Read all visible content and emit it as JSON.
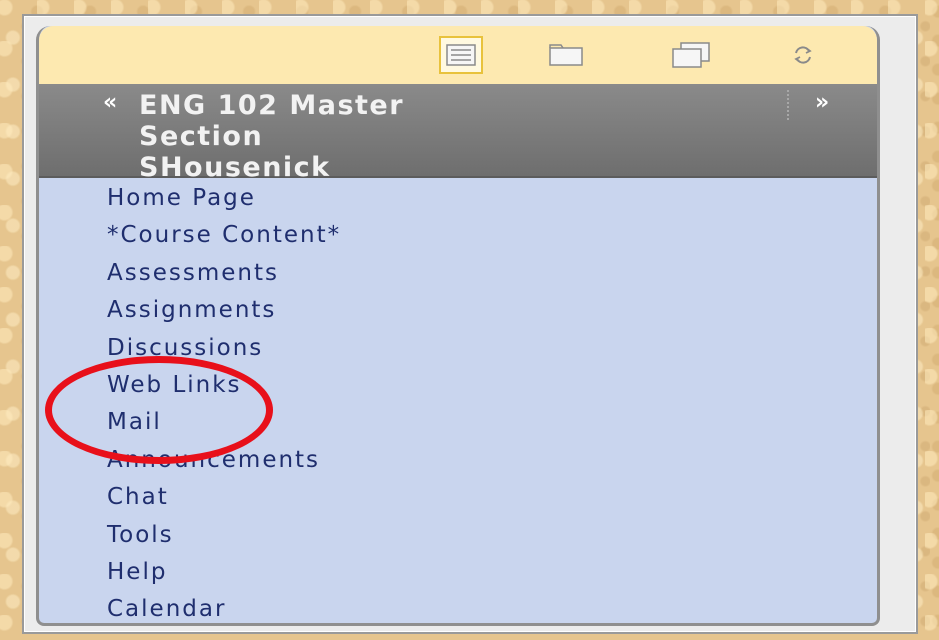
{
  "toolbar": {
    "buttons": [
      {
        "name": "list-view-icon",
        "active": true
      },
      {
        "name": "folder-icon",
        "active": false
      },
      {
        "name": "windows-icon",
        "active": false
      },
      {
        "name": "refresh-icon",
        "active": false
      }
    ]
  },
  "course": {
    "title_lines": [
      "ENG 102 Master",
      "Section",
      "SHousenick"
    ],
    "collapse_glyph": "«",
    "expand_glyph": "»"
  },
  "menu": {
    "items": [
      {
        "id": "home-page",
        "label": "Home Page"
      },
      {
        "id": "course-content",
        "label": "*Course Content*"
      },
      {
        "id": "assessments",
        "label": "Assessments"
      },
      {
        "id": "assignments",
        "label": "Assignments"
      },
      {
        "id": "discussions",
        "label": "Discussions"
      },
      {
        "id": "web-links",
        "label": "Web Links"
      },
      {
        "id": "mail",
        "label": "Mail"
      },
      {
        "id": "announcements",
        "label": "Announcements"
      },
      {
        "id": "chat",
        "label": "Chat"
      },
      {
        "id": "tools",
        "label": "Tools"
      },
      {
        "id": "help",
        "label": "Help"
      },
      {
        "id": "calendar",
        "label": "Calendar"
      }
    ]
  },
  "annotation": {
    "highlighted_item": "Mail",
    "color": "#e8101a"
  },
  "colors": {
    "background": "#e6c58e",
    "toolbar": "#fde9b0",
    "header": "#7c7c7c",
    "menu_bg": "#c9d5ee",
    "menu_text": "#1f2e6e"
  }
}
